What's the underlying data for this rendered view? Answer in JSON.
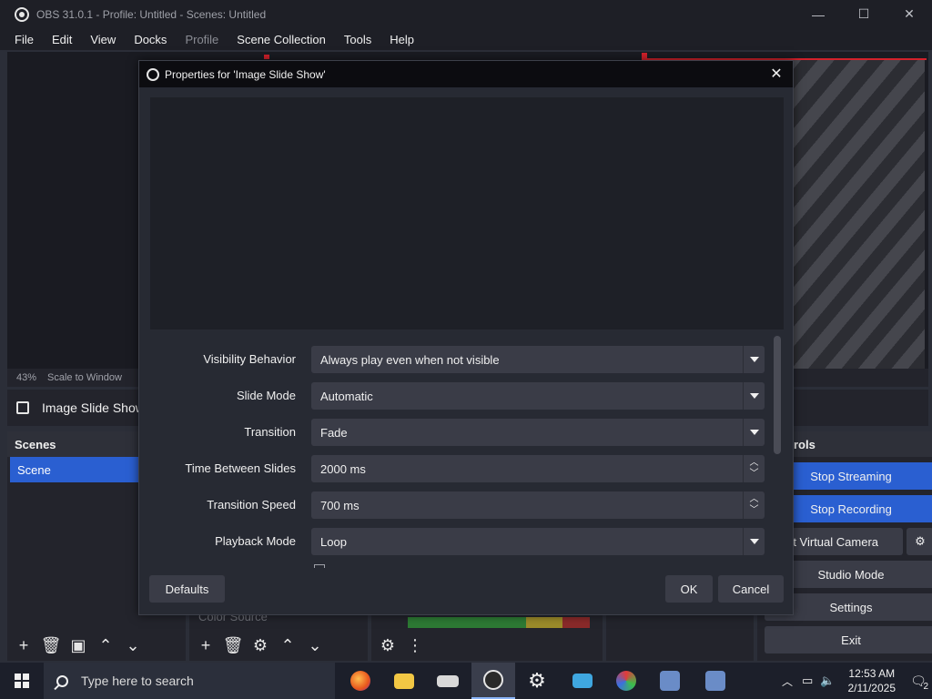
{
  "window": {
    "title": "OBS 31.0.1 - Profile: Untitled - Scenes: Untitled",
    "minimize": "—",
    "maximize": "☐",
    "close": "✕"
  },
  "menu": [
    "File",
    "Edit",
    "View",
    "Docks",
    "Profile",
    "Scene Collection",
    "Tools",
    "Help"
  ],
  "status": {
    "zoom": "43%",
    "scale_mode": "Scale to Window"
  },
  "source_bar": {
    "selected_source": "Image Slide Show"
  },
  "scenes": {
    "header": "Scenes",
    "items": [
      "Scene"
    ]
  },
  "sources": {
    "faded_item": "Color Source"
  },
  "controls": {
    "header": "rols",
    "stop_streaming": "Stop Streaming",
    "stop_recording": "Stop Recording",
    "virtual_camera": "rt Virtual Camera",
    "studio_mode": "Studio Mode",
    "settings": "Settings",
    "exit": "Exit"
  },
  "dialog": {
    "title": "Properties for 'Image Slide Show'",
    "close": "✕",
    "properties": [
      {
        "label": "Visibility Behavior",
        "value": "Always play even when not visible",
        "kind": "dropdown"
      },
      {
        "label": "Slide Mode",
        "value": "Automatic",
        "kind": "dropdown"
      },
      {
        "label": "Transition",
        "value": "Fade",
        "kind": "dropdown"
      },
      {
        "label": "Time Between Slides",
        "value": "2000 ms",
        "kind": "spinbox"
      },
      {
        "label": "Transition Speed",
        "value": "700 ms",
        "kind": "spinbox"
      },
      {
        "label": "Playback Mode",
        "value": "Loop",
        "kind": "dropdown"
      }
    ],
    "defaults_button": "Defaults",
    "ok_button": "OK",
    "cancel_button": "Cancel"
  },
  "taskbar": {
    "search_placeholder": "Type here to search",
    "time": "12:53 AM",
    "date": "2/11/2025",
    "notification_count": "2",
    "apps": [
      "firefox-icon",
      "file-explorer-icon",
      "keyboard-app-icon",
      "obs-icon",
      "settings-icon",
      "remote-desktop-icon",
      "color-app-icon",
      "network-app-icon",
      "network-app2-icon"
    ]
  },
  "colors": {
    "accent": "#2a5fd1",
    "recording_red": "#d3212b"
  }
}
